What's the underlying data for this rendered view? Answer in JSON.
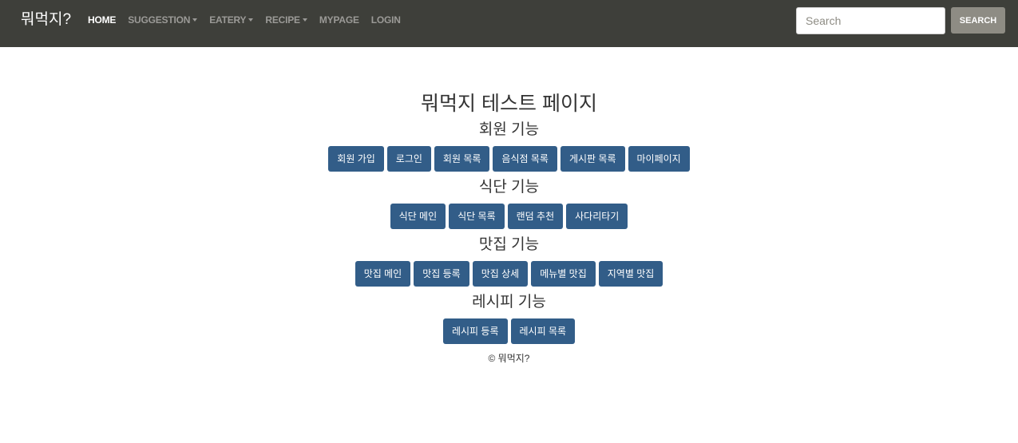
{
  "navbar": {
    "brand": "뭐먹지?",
    "links": [
      {
        "label": "HOME",
        "active": true,
        "dropdown": false
      },
      {
        "label": "SUGGESTION",
        "active": false,
        "dropdown": true
      },
      {
        "label": "EATERY",
        "active": false,
        "dropdown": true
      },
      {
        "label": "RECIPE",
        "active": false,
        "dropdown": true
      },
      {
        "label": "MYPAGE",
        "active": false,
        "dropdown": false
      },
      {
        "label": "LOGIN",
        "active": false,
        "dropdown": false
      }
    ],
    "search_placeholder": "Search",
    "search_button": "SEARCH",
    "background_color": "#3e3f3a"
  },
  "main": {
    "title": "뭐먹지 테스트 페이지",
    "sections": [
      {
        "title": "회원 기능",
        "buttons": [
          "회원 가입",
          "로그인",
          "회원 목록",
          "음식점 목록",
          "게시판 목록",
          "마이페이지"
        ]
      },
      {
        "title": "식단 기능",
        "buttons": [
          "식단 메인",
          "식단 목록",
          "랜덤 추천",
          "사다리타기"
        ]
      },
      {
        "title": "맛집 기능",
        "buttons": [
          "맛집 메인",
          "맛집 등록",
          "맛집 상세",
          "메뉴별 맛집",
          "지역별 맛집"
        ]
      },
      {
        "title": "레시피 기능",
        "buttons": [
          "레시피 등록",
          "레시피 목록"
        ]
      }
    ],
    "button_color": "#325d88"
  },
  "footer": {
    "text": "© 뭐먹지?"
  }
}
